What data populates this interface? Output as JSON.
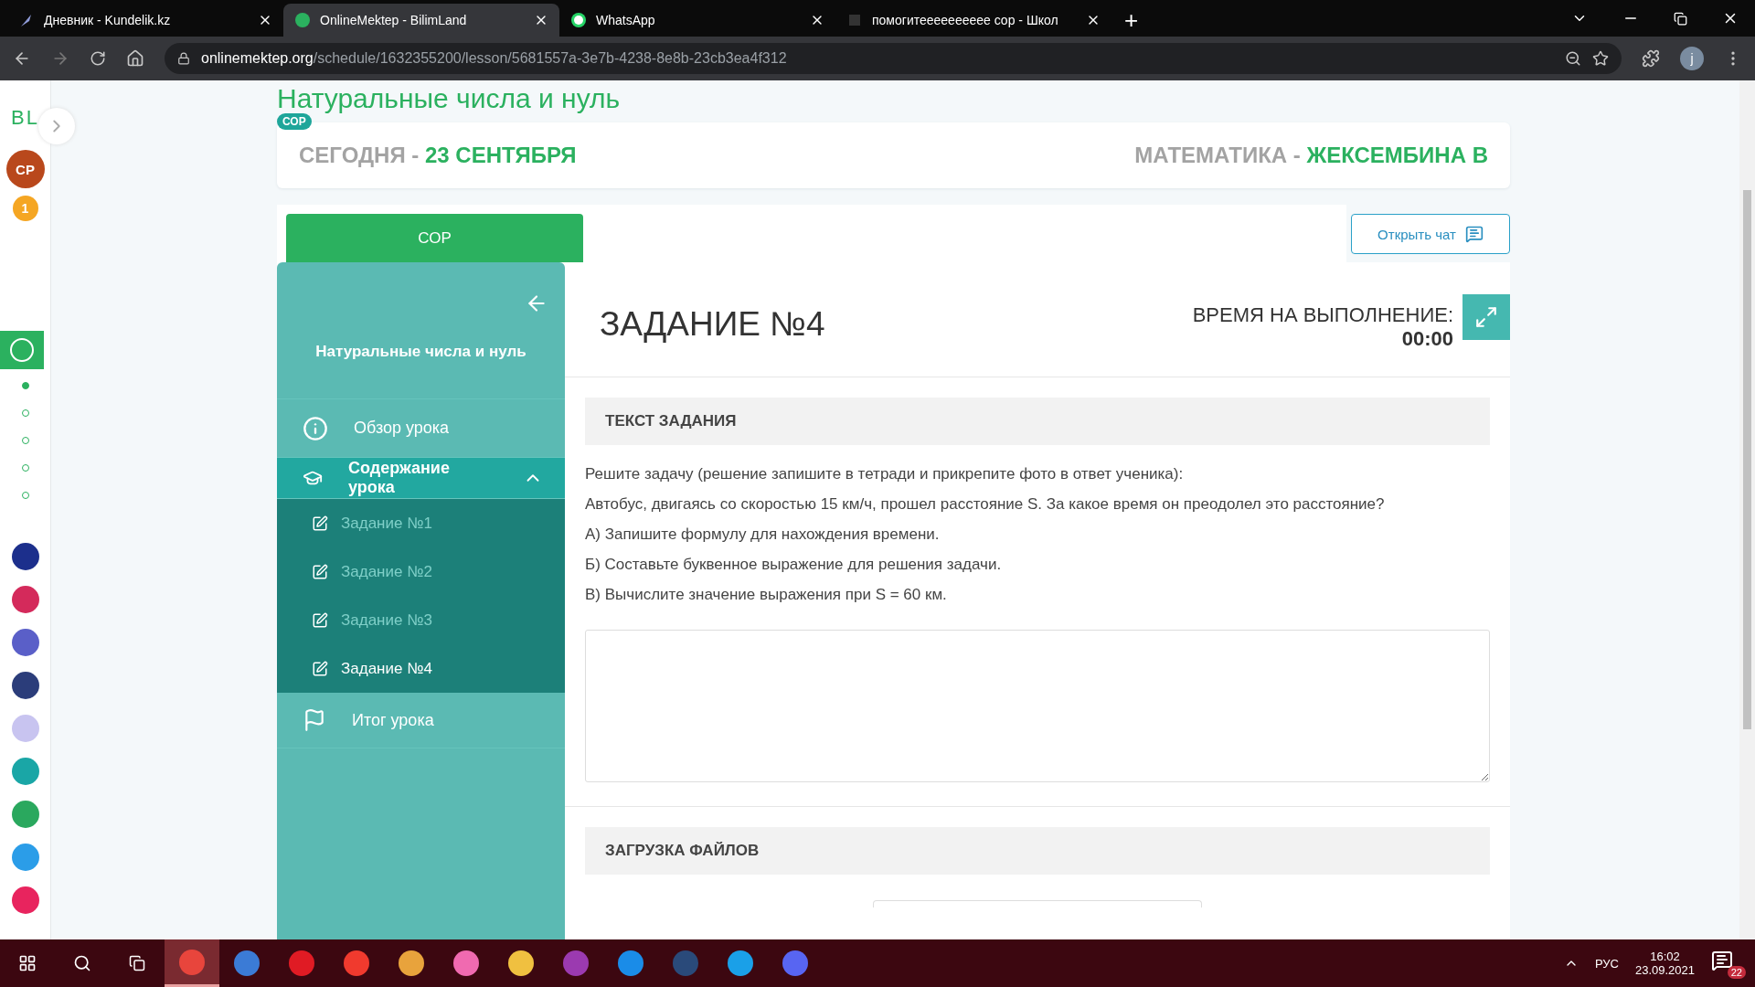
{
  "browser": {
    "tabs": [
      {
        "title": "Дневник - Kundelik.kz",
        "selected": false,
        "kind": "diary"
      },
      {
        "title": "OnlineMektep - BilimLand",
        "selected": true,
        "kind": "bilim"
      },
      {
        "title": "WhatsApp",
        "selected": false,
        "kind": "whatsapp"
      },
      {
        "title": "помогитееееееееее сор - Школ",
        "selected": false,
        "kind": "znanija"
      }
    ],
    "new_tab": "+",
    "url_host": "onlinemektep.org",
    "url_path": "/schedule/1632355200/lesson/5681557a-3e7b-4238-8e8b-23cb3ea4f312",
    "profile": "j"
  },
  "rail": {
    "logo": "BL",
    "avatar": "CP",
    "badge": "1",
    "steps": [
      {
        "selected": true
      },
      {
        "selected": false
      },
      {
        "selected": false
      },
      {
        "selected": false
      },
      {
        "selected": false
      }
    ],
    "apps": [
      {
        "color": "#1c2f8c"
      },
      {
        "color": "#d42a5b"
      },
      {
        "color": "#5a5fc8"
      },
      {
        "color": "#2b3d7a"
      },
      {
        "color": "#c8c4f0"
      },
      {
        "color": "#1aa6a6"
      },
      {
        "color": "#2aa85e"
      },
      {
        "color": "#2b9de8"
      },
      {
        "color": "#e8245e"
      }
    ]
  },
  "page": {
    "lesson_title": "Натуральные числа и нуль",
    "badge": "СОР",
    "today_label": "СЕГОДНЯ - ",
    "date": "23 СЕНТЯБРЯ",
    "subject_label": "МАТЕМАТИКА - ",
    "teacher": "ЖЕКСЕМБИНА В",
    "tab": {
      "label": "СОР",
      "selected": true
    },
    "chat_button": "Открыть чат"
  },
  "sidebar": {
    "title": "Натуральные числа и нуль",
    "items": [
      {
        "label": "Обзор урока",
        "kind": "info",
        "selected": false
      },
      {
        "label": "Содержание урока",
        "kind": "cap",
        "selected": true,
        "expanded": true,
        "children": [
          {
            "label": "Задание №1",
            "selected": false
          },
          {
            "label": "Задание №2",
            "selected": false
          },
          {
            "label": "Задание №3",
            "selected": false
          },
          {
            "label": "Задание №4",
            "selected": true
          }
        ]
      },
      {
        "label": "Итог урока",
        "kind": "flag",
        "selected": false
      }
    ]
  },
  "task": {
    "title": "ЗАДАНИЕ №4",
    "timer_label": "ВРЕМЯ НА ВЫПОЛНЕНИЕ:",
    "timer": "00:00",
    "text_heading": "ТЕКСТ ЗАДАНИЯ",
    "paragraphs": [
      "Решите задачу (решение запишите в тетради и прикрепите фото в ответ ученика):",
      "Автобус, двигаясь со скоростью 15 км/ч, прошел расстояние S. За какое время он преодолел это расстояние?",
      "А) Запишите формулу для нахождения времени.",
      "Б) Составьте буквенное выражение для решения задачи.",
      "В) Вычислите значение выражения при S = 60 км."
    ],
    "upload_heading": "ЗАГРУЗКА ФАЙЛОВ"
  },
  "taskbar": {
    "apps": [
      {
        "color": "#e8453c",
        "active": true
      },
      {
        "color": "#3b7bd6",
        "active": false
      },
      {
        "color": "#e01b24",
        "active": false
      },
      {
        "color": "#f03a2e",
        "active": false
      },
      {
        "color": "#e8a33c",
        "active": false
      },
      {
        "color": "#f06ab0",
        "active": false
      },
      {
        "color": "#f0c040",
        "active": false
      },
      {
        "color": "#9b3ab0",
        "active": false
      },
      {
        "color": "#1a8ce8",
        "active": false
      },
      {
        "color": "#2a4a7a",
        "active": false
      },
      {
        "color": "#1aa0e8",
        "active": false
      },
      {
        "color": "#5865f2",
        "active": false
      }
    ],
    "language": "РУС",
    "time": "16:02",
    "date": "23.09.2021",
    "notifications": "22"
  }
}
